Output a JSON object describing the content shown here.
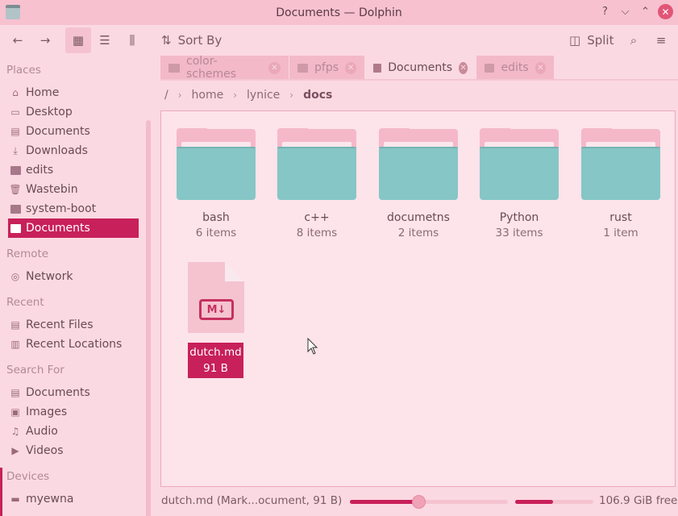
{
  "window": {
    "title": "Documents — Dolphin",
    "help": "?",
    "minimize": "⌵",
    "maximize": "⌃",
    "close": "✕"
  },
  "toolbar": {
    "back": "←",
    "forward": "→",
    "icons_view": "▦",
    "details_view": "☰",
    "compact_view": "⫼",
    "sort_label": "Sort By",
    "split_label": "Split",
    "search": "⌕",
    "menu": "≡"
  },
  "sidebar": {
    "places_label": "Places",
    "places": [
      {
        "label": "Home",
        "icon": "home-icon"
      },
      {
        "label": "Desktop",
        "icon": "desktop-icon"
      },
      {
        "label": "Documents",
        "icon": "document-icon"
      },
      {
        "label": "Downloads",
        "icon": "download-icon"
      },
      {
        "label": "edits",
        "icon": "folder-icon"
      },
      {
        "label": "Wastebin",
        "icon": "trash-icon"
      },
      {
        "label": "system-boot",
        "icon": "folder-icon"
      },
      {
        "label": "Documents",
        "icon": "folder-icon",
        "active": true
      }
    ],
    "remote_label": "Remote",
    "remote": [
      {
        "label": "Network",
        "icon": "network-icon"
      }
    ],
    "recent_label": "Recent",
    "recent": [
      {
        "label": "Recent Files",
        "icon": "recent-files-icon"
      },
      {
        "label": "Recent Locations",
        "icon": "recent-locations-icon"
      }
    ],
    "search_label": "Search For",
    "search": [
      {
        "label": "Documents",
        "icon": "document-icon"
      },
      {
        "label": "Images",
        "icon": "image-icon"
      },
      {
        "label": "Audio",
        "icon": "audio-icon"
      },
      {
        "label": "Videos",
        "icon": "video-icon"
      }
    ],
    "devices_label": "Devices",
    "devices": [
      {
        "label": "myewna",
        "icon": "drive-icon"
      }
    ]
  },
  "tabs": [
    {
      "label": "color-schemes"
    },
    {
      "label": "pfps"
    },
    {
      "label": "Documents",
      "current": true
    },
    {
      "label": "edits"
    }
  ],
  "breadcrumb": {
    "root": "/",
    "parts": [
      "home",
      "lynice"
    ],
    "current": "docs"
  },
  "folders": [
    {
      "name": "bash",
      "count": "6 items"
    },
    {
      "name": "c++",
      "count": "8 items"
    },
    {
      "name": "documetns",
      "count": "2 items"
    },
    {
      "name": "Python",
      "count": "33 items"
    },
    {
      "name": "rust",
      "count": "1 item"
    }
  ],
  "file": {
    "name": "dutch.md",
    "size": "91 B",
    "badge": "M↓"
  },
  "status": {
    "text": "dutch.md (Mark...ocument, 91 B)",
    "zoom_fraction": 0.44,
    "space_used_fraction": 0.48,
    "free": "106.9 GiB free"
  },
  "colors": {
    "accent": "#c8205a",
    "folder_front": "#86c6c6",
    "background": "#fbd9e2"
  }
}
